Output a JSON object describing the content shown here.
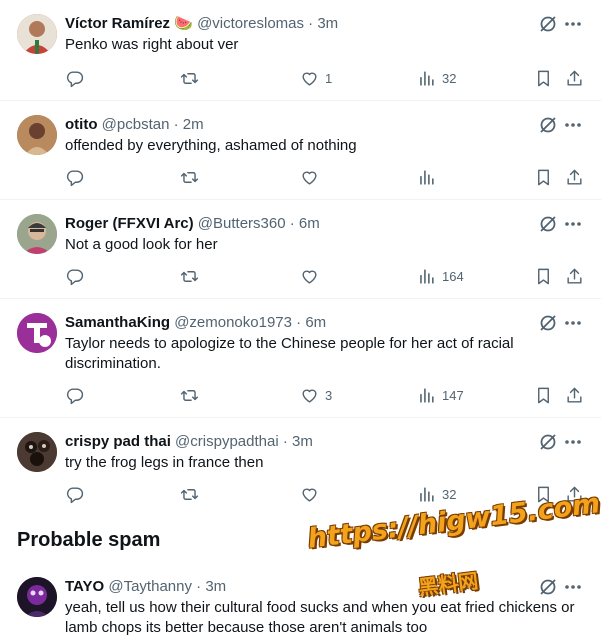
{
  "tweets": [
    {
      "name": "Víctor Ramírez",
      "name_emoji": "🍉",
      "handle": "@victoreslomas",
      "time": "3m",
      "text": "Penko was right about ver",
      "likes": "1",
      "views": "32",
      "avatar_color": "#c9423a"
    },
    {
      "name": "otito",
      "handle": "@pcbstan",
      "time": "2m",
      "text": "offended by everything, ashamed of nothing",
      "likes": "",
      "views": "",
      "avatar_color": "#8a5a3c"
    },
    {
      "name": "Roger (FFXVI Arc)",
      "handle": "@Butters360",
      "time": "6m",
      "text": "Not a good look for her",
      "likes": "",
      "views": "164",
      "avatar_color": "#7c8a6e"
    },
    {
      "name": "SamanthaKing",
      "handle": "@zemonoko1973",
      "time": "6m",
      "text": "Taylor needs to apologize to the Chinese people for her act of racial discrimination.",
      "likes": "3",
      "views": "147",
      "avatar_color": "#8e2a8e"
    },
    {
      "name": "crispy pad thai",
      "handle": "@crispypadthai",
      "time": "3m",
      "text": "try the frog legs in france then",
      "likes": "",
      "views": "32",
      "avatar_color": "#3a2a24"
    }
  ],
  "section": {
    "title": "Probable spam"
  },
  "spam_tweet": {
    "name": "TAYO",
    "handle": "@Taythanny",
    "time": "3m",
    "text": "yeah, tell us how their cultural food sucks and when you eat fried chickens or lamb chops its better because those aren't animals too",
    "avatar_color": "#2a1a3a"
  },
  "separator": "·",
  "watermark": {
    "url": "https://higw15.com",
    "cn": "黑料网"
  },
  "colors": {
    "text": "#0f1419",
    "secondary": "#536471",
    "divider": "#eff3f4",
    "watermark": "#f2a31b"
  }
}
